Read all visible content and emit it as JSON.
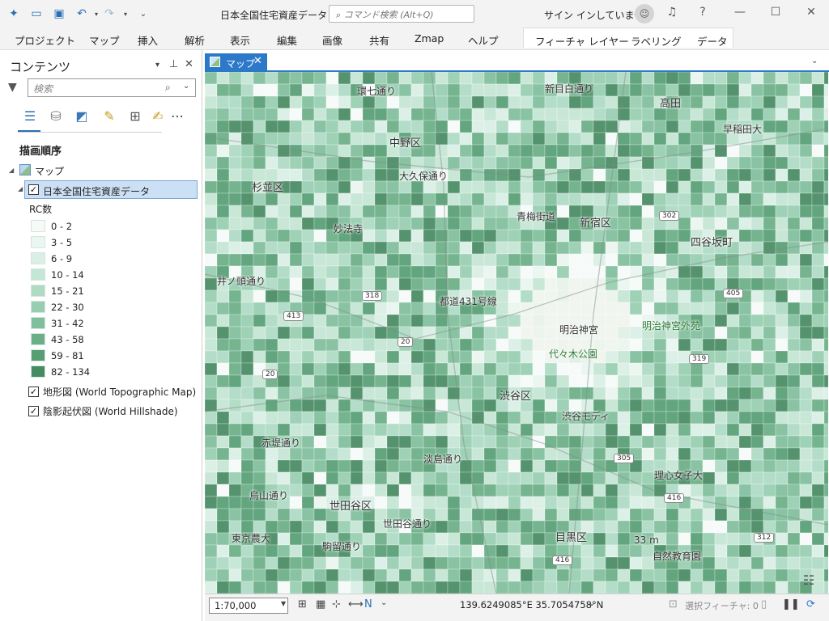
{
  "window": {
    "title": "日本全国住宅資産データ",
    "search_placeholder": "コマンド検索 (Alt+Q)",
    "signin": "サイン インしていません"
  },
  "ribbon": {
    "tabs": [
      "プロジェクト",
      "マップ",
      "挿入",
      "解析",
      "表示",
      "編集",
      "画像",
      "共有",
      "Zmap",
      "ヘルプ"
    ],
    "context_tabs": [
      "フィーチャ レイヤー",
      "ラベリング",
      "データ"
    ]
  },
  "contents": {
    "title": "コンテンツ",
    "search_placeholder": "検索",
    "drawing_order": "描画順序",
    "map_node": "マップ",
    "layer": "日本全国住宅資産データ",
    "field_label": "RC数",
    "legend": [
      {
        "label": "0 - 2",
        "color": "#f6fbf8"
      },
      {
        "label": "3 - 5",
        "color": "#eaf6f1"
      },
      {
        "label": "6 - 9",
        "color": "#daf0e6"
      },
      {
        "label": "10 - 14",
        "color": "#c4e6d5"
      },
      {
        "label": "15 - 21",
        "color": "#aedbc4"
      },
      {
        "label": "22 - 30",
        "color": "#97ceb1"
      },
      {
        "label": "31 - 42",
        "color": "#80bf9c"
      },
      {
        "label": "43 - 58",
        "color": "#6aaf87"
      },
      {
        "label": "59 - 81",
        "color": "#579e74"
      },
      {
        "label": "82 - 134",
        "color": "#468b62"
      }
    ],
    "basemaps": [
      "地形図 (World Topographic Map)",
      "陰影起伏図 (World Hillshade)"
    ]
  },
  "map_view": {
    "tab": "マップ",
    "places": [
      {
        "name": "中野区",
        "kind": "big"
      },
      {
        "name": "杉並区",
        "kind": "big"
      },
      {
        "name": "新宿区",
        "kind": "big"
      },
      {
        "name": "四谷坂町",
        "kind": "big"
      },
      {
        "name": "高田",
        "kind": "big"
      },
      {
        "name": "渋谷区",
        "kind": "big"
      },
      {
        "name": "世田谷区",
        "kind": "big"
      },
      {
        "name": "目黒区",
        "kind": "big"
      },
      {
        "name": "妙法寺",
        "kind": "small"
      },
      {
        "name": "明治神宮",
        "kind": "small"
      },
      {
        "name": "明治神宮外苑",
        "kind": "green"
      },
      {
        "name": "代々木公園",
        "kind": "green"
      },
      {
        "name": "渋谷モディ",
        "kind": "small"
      },
      {
        "name": "東京農大",
        "kind": "small"
      },
      {
        "name": "駒留通り",
        "kind": "small"
      },
      {
        "name": "理心女子大",
        "kind": "small"
      },
      {
        "name": "自然教育園",
        "kind": "small"
      },
      {
        "name": "早稲田大",
        "kind": "small"
      },
      {
        "name": "新目白通り",
        "kind": "small"
      },
      {
        "name": "大久保通り",
        "kind": "small"
      },
      {
        "name": "青梅街道",
        "kind": "small"
      },
      {
        "name": "都道431号線",
        "kind": "small"
      },
      {
        "name": "環七通り",
        "kind": "small"
      },
      {
        "name": "井ノ頭通り",
        "kind": "small"
      },
      {
        "name": "世田谷通り",
        "kind": "small"
      },
      {
        "name": "淡島通り",
        "kind": "small"
      },
      {
        "name": "烏山通り",
        "kind": "small"
      },
      {
        "name": "赤堤通り",
        "kind": "small"
      },
      {
        "name": "33 m",
        "kind": "small"
      }
    ],
    "shields": [
      "413",
      "318",
      "20",
      "302",
      "405",
      "319",
      "305",
      "416",
      "312",
      "416",
      "20"
    ]
  },
  "status": {
    "scale": "1:70,000",
    "coords": "139.6249085°E 35.7054758°N",
    "selected": "選択フィーチャ: 0"
  }
}
